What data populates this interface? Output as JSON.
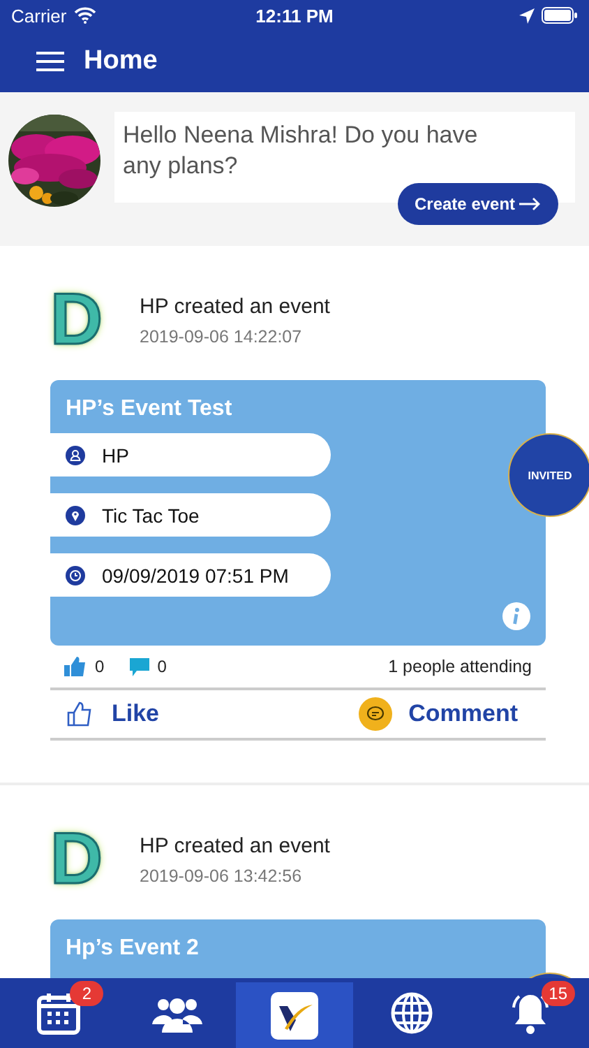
{
  "status_bar": {
    "carrier": "Carrier",
    "time": "12:11 PM"
  },
  "header": {
    "title": "Home"
  },
  "composer": {
    "greeting": "Hello Neena Mishra! Do you have any plans?",
    "button": "Create event"
  },
  "posts": [
    {
      "avatar_letter": "D",
      "headline": "HP created an event",
      "timestamp": "2019-09-06 14:22:07",
      "event": {
        "title": "HP’s Event Test",
        "badge_shown": true,
        "badge_text": "INVITED",
        "details": [
          {
            "kind": "host",
            "text": "HP"
          },
          {
            "kind": "place",
            "text": "Tic Tac Toe"
          },
          {
            "kind": "time",
            "text": "09/09/2019 07:51 PM"
          }
        ],
        "info": true
      },
      "likes": "0",
      "comments": "0",
      "attending": "1 people attending",
      "like_label": "Like",
      "comment_label": "Comment"
    },
    {
      "avatar_letter": "D",
      "headline": "HP created an event",
      "timestamp": "2019-09-06 13:42:56",
      "event": {
        "title": "Hp’s Event 2",
        "badge_shown": true
      }
    }
  ],
  "tab_bar": [
    {
      "kind": "calendar",
      "selected": false,
      "badge": "2"
    },
    {
      "kind": "people",
      "selected": false
    },
    {
      "kind": "logo",
      "selected": true
    },
    {
      "kind": "globe",
      "selected": false
    },
    {
      "kind": "bell",
      "selected": false,
      "badge": "15"
    }
  ]
}
